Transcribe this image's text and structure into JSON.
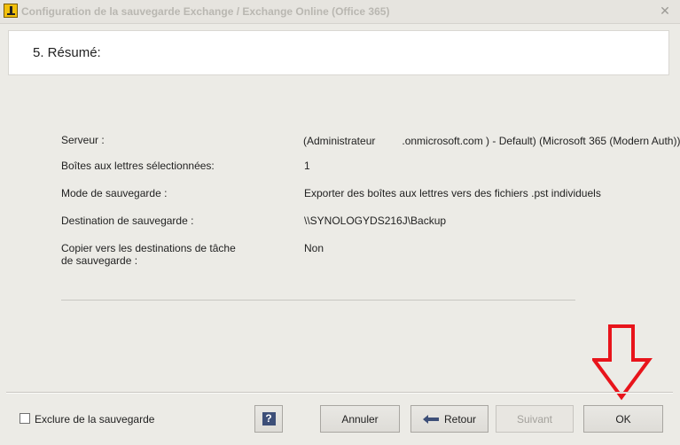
{
  "window": {
    "title": "Configuration de la sauvegarde Exchange / Exchange Online (Office 365)",
    "close_icon": "close-icon",
    "app_icon": "app-icon"
  },
  "header": {
    "step_title": "5. Résumé:"
  },
  "summary": {
    "server_label": "Serveur :",
    "server_value_prefix": "(Administrateur",
    "server_value_suffix": ".onmicrosoft.com ) - Default) (Microsoft 365 (Modern Auth))",
    "mailboxes_label": "Boîtes aux lettres sélectionnées:",
    "mailboxes_value": "1",
    "mode_label": "Mode de sauvegarde :",
    "mode_value": "Exporter des boîtes aux lettres vers des fichiers .pst individuels",
    "destination_label": "Destination de sauvegarde :",
    "destination_value": "\\\\SYNOLOGYDS216J\\Backup",
    "copy_label_line1": "Copier vers les destinations de tâche",
    "copy_label_line2": "de sauvegarde :",
    "copy_value": "Non"
  },
  "footer": {
    "exclude_label": "Exclure de la sauvegarde",
    "exclude_checked": false,
    "help_label": "?",
    "cancel_label": "Annuler",
    "back_label": "Retour",
    "next_label": "Suivant",
    "ok_label": "OK"
  },
  "colors": {
    "annotation_arrow": "#e8141b",
    "help_icon_bg": "#3d4f78",
    "app_icon_bg": "#f2c00b"
  }
}
